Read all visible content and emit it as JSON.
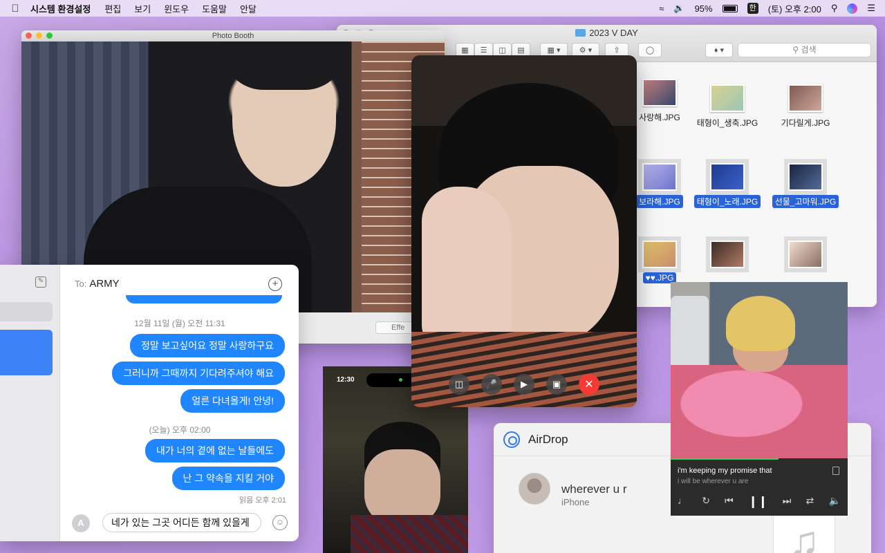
{
  "menubar": {
    "apple_icon": "apple-logo",
    "app_name": "시스템 환경설정",
    "menus": [
      "편집",
      "보기",
      "윈도우",
      "도움말",
      "안달"
    ],
    "battery_percent": "95%",
    "input_source": "한",
    "clock": "(토) 오후 2:00"
  },
  "finder": {
    "title": "2023 V DAY",
    "search_placeholder": "검색",
    "files": [
      {
        "name": "사랑해.JPG",
        "selected": false
      },
      {
        "name": "태형이_생축.JPG",
        "selected": false
      },
      {
        "name": "기다릴게.JPG",
        "selected": false
      },
      {
        "name": "보라해.JPG",
        "selected": true
      },
      {
        "name": "태형이_노래.JPG",
        "selected": true
      },
      {
        "name": "선물_고마워.JPG",
        "selected": true
      },
      {
        "name": "♥♥.JPG",
        "selected": true
      }
    ],
    "colors": {
      "selection": "#2a63d8"
    }
  },
  "photobooth": {
    "title": "Photo Booth",
    "effects_label": "Effe"
  },
  "facetime": {
    "controls": [
      "sidebar-icon",
      "microphone-icon",
      "video-camera-icon",
      "screen-share-icon",
      "end-call-icon"
    ]
  },
  "phone_video": {
    "status_time": "12:30"
  },
  "messages": {
    "to_label": "To:",
    "recipient": "ARMY",
    "thread": [
      {
        "type": "timestamp",
        "text": "12월 11일 (월) 오전 11:31"
      },
      {
        "type": "bubble",
        "text": "정말 보고싶어요 정말 사랑하구요"
      },
      {
        "type": "bubble",
        "text": "그러니까 그때까지 기다려주셔야 해요"
      },
      {
        "type": "bubble",
        "text": "얼른 다녀올게! 안녕!"
      },
      {
        "type": "timestamp",
        "text": "(오늘) 오후 02:00"
      },
      {
        "type": "bubble",
        "text": "내가 너의 곁에 없는 날들에도"
      },
      {
        "type": "bubble",
        "text": "난 그 약속을 지킬 거야"
      },
      {
        "type": "receipt",
        "text": "읽음 오후 2:01"
      }
    ],
    "draft": "네가 있는 그곳 어디든 함께 있을게",
    "colors": {
      "bubble": "#1f86ff",
      "sidebar_selected": "#3e82f7"
    }
  },
  "airdrop": {
    "title": "AirDrop",
    "device_name": "wherever u r",
    "device_type": "iPhone"
  },
  "music": {
    "track_title": "i'm keeping my promise that",
    "track_subtitle": "i will be wherever u are",
    "progress": 0.61,
    "colors": {
      "progress": "#2fd159"
    }
  }
}
